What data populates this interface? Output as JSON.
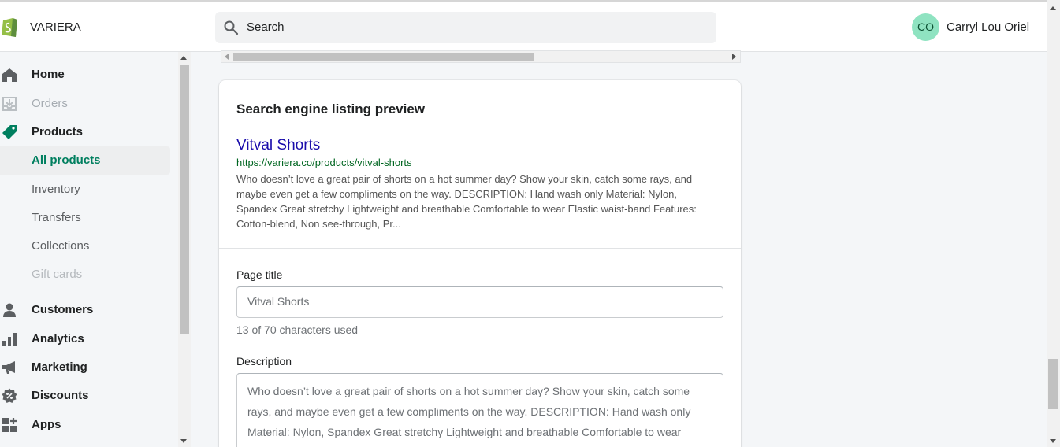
{
  "colors": {
    "brand": "#95bf47",
    "accent_green": "#007f5f",
    "link_blue": "#1a0dab",
    "url_green": "#006621",
    "avatar_bg": "#8fe3c1"
  },
  "header": {
    "store_name": "VARIERA",
    "search_placeholder": "Search",
    "user_initials": "CO",
    "user_name": "Carryl Lou Oriel"
  },
  "sidebar": {
    "items": [
      {
        "label": "Home",
        "icon": "home-icon"
      },
      {
        "label": "Orders",
        "icon": "orders-icon"
      },
      {
        "label": "Products",
        "icon": "tag-icon"
      },
      {
        "label": "All products"
      },
      {
        "label": "Inventory"
      },
      {
        "label": "Transfers"
      },
      {
        "label": "Collections"
      },
      {
        "label": "Gift cards"
      },
      {
        "label": "Customers",
        "icon": "person-icon"
      },
      {
        "label": "Analytics",
        "icon": "bar-chart-icon"
      },
      {
        "label": "Marketing",
        "icon": "megaphone-icon"
      },
      {
        "label": "Discounts",
        "icon": "discount-icon"
      },
      {
        "label": "Apps",
        "icon": "apps-icon"
      }
    ]
  },
  "seo": {
    "card_title": "Search engine listing preview",
    "preview_title": "Vitval Shorts",
    "preview_url": "https://variera.co/products/vitval-shorts",
    "preview_description": "Who doesn’t love a great pair of shorts on a hot summer day? Show your skin, catch some rays, and maybe even get a few compliments on the way. DESCRIPTION: Hand wash only Material: Nylon, Spandex Great stretchy Lightweight and breathable Comfortable to wear Elastic waist-band Features: Cotton-blend, Non see-through, Pr...",
    "page_title_label": "Page title",
    "page_title_value": "Vitval Shorts",
    "char_count": "13 of 70 characters used",
    "description_label": "Description",
    "description_value": "Who doesn’t love a great pair of shorts on a hot summer day? Show your skin, catch some rays, and maybe even get a few compliments on the way. DESCRIPTION: Hand wash only Material: Nylon, Spandex Great stretchy Lightweight and breathable Comfortable to wear Elastic waist-band Features: Cotton-blend, Non see-through, Pr"
  }
}
